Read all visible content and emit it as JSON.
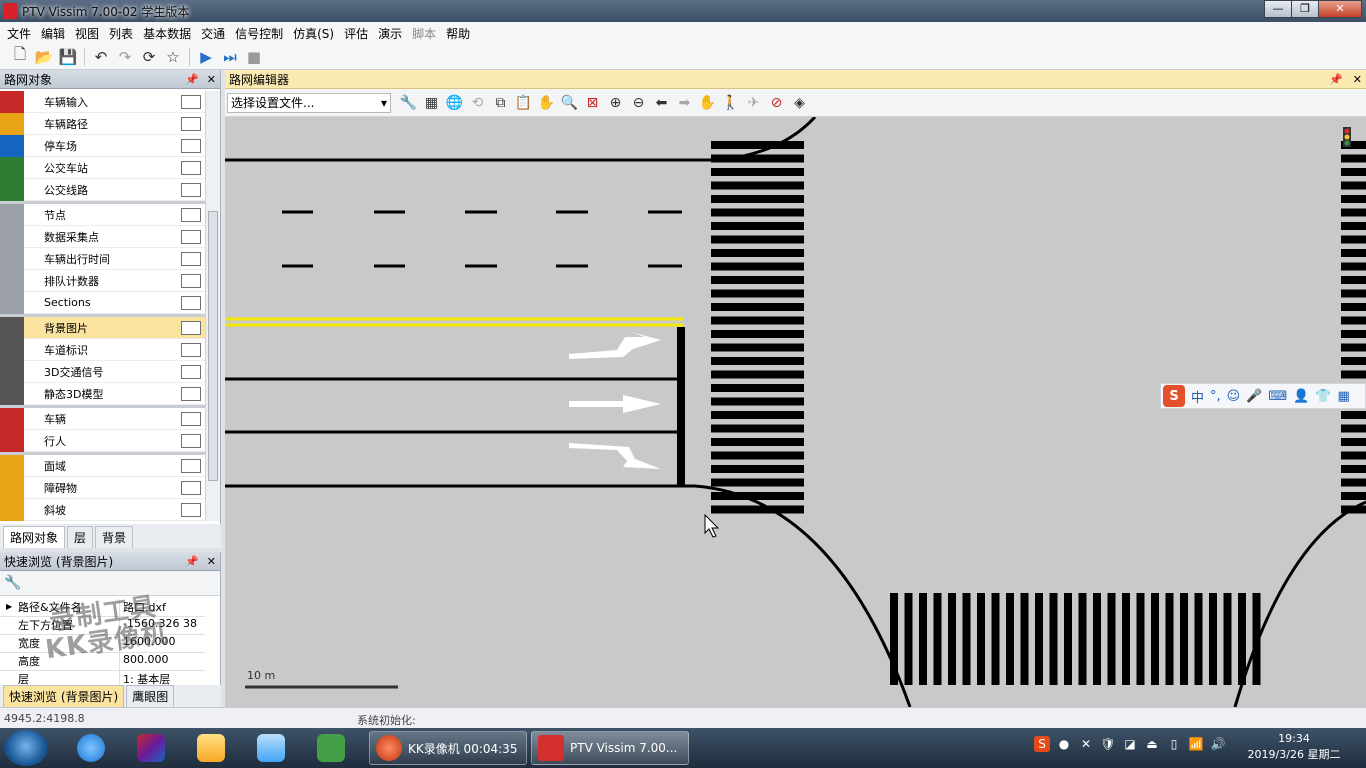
{
  "window": {
    "title": "PTV Vissim 7.00-02 学生版本",
    "minimize": "—",
    "restore": "❐",
    "close": "✕"
  },
  "menu": [
    {
      "label": "文件",
      "enabled": true
    },
    {
      "label": "编辑",
      "enabled": true
    },
    {
      "label": "视图",
      "enabled": true
    },
    {
      "label": "列表",
      "enabled": true
    },
    {
      "label": "基本数据",
      "enabled": true
    },
    {
      "label": "交通",
      "enabled": true
    },
    {
      "label": "信号控制",
      "enabled": true
    },
    {
      "label": "仿真(S)",
      "enabled": true
    },
    {
      "label": "评估",
      "enabled": true
    },
    {
      "label": "演示",
      "enabled": true
    },
    {
      "label": "脚本",
      "enabled": false
    },
    {
      "label": "帮助",
      "enabled": true
    }
  ],
  "network_objects_panel": {
    "title": "路网对象",
    "items": [
      {
        "label": "车辆输入",
        "icon": "car-input-icon",
        "color": "#c62828"
      },
      {
        "label": "车辆路径",
        "icon": "route-icon",
        "color": "#e8a317"
      },
      {
        "label": "停车场",
        "icon": "parking-icon",
        "color": "#1565c0"
      },
      {
        "label": "公交车站",
        "icon": "bus-stop-icon",
        "color": "#2e7d32"
      },
      {
        "label": "公交线路",
        "icon": "bus-line-icon",
        "color": "#2e7d32"
      },
      {
        "label": "节点",
        "icon": "node-icon",
        "color": "#9aa0a6"
      },
      {
        "label": "数据采集点",
        "icon": "data-collection-icon",
        "color": "#9aa0a6"
      },
      {
        "label": "车辆出行时间",
        "icon": "travel-time-icon",
        "color": "#9aa0a6"
      },
      {
        "label": "排队计数器",
        "icon": "queue-counter-icon",
        "color": "#9aa0a6"
      },
      {
        "label": "Sections",
        "icon": "sections-icon",
        "color": "#9aa0a6"
      },
      {
        "label": "背景图片",
        "icon": "background-image-icon",
        "color": "#555555"
      },
      {
        "label": "车道标识",
        "icon": "lane-marking-icon",
        "color": "#555555"
      },
      {
        "label": "3D交通信号",
        "icon": "3d-signal-icon",
        "color": "#555555"
      },
      {
        "label": "静态3D模型",
        "icon": "static-3d-icon",
        "color": "#555555"
      },
      {
        "label": "车辆",
        "icon": "vehicle-icon",
        "color": "#c62828"
      },
      {
        "label": "行人",
        "icon": "pedestrian-icon",
        "color": "#c62828"
      },
      {
        "label": "面域",
        "icon": "area-icon",
        "color": "#e8a317"
      },
      {
        "label": "障碍物",
        "icon": "obstacle-icon",
        "color": "#e8a317"
      },
      {
        "label": "斜坡",
        "icon": "ramp-icon",
        "color": "#e8a317"
      }
    ],
    "selected": "背景图片",
    "tabs": [
      "路网对象",
      "层",
      "背景"
    ]
  },
  "quick_view": {
    "title": "快速浏览 (背景图片)",
    "rows": [
      {
        "key": "路径&文件名",
        "value": "路口.dxf"
      },
      {
        "key": "左下方位置",
        "value": "-1560.326 38"
      },
      {
        "key": "宽度",
        "value": "1600.000"
      },
      {
        "key": "高度",
        "value": "800.000"
      },
      {
        "key": "层",
        "value": "1: 基本层"
      }
    ],
    "tabs": [
      "快速浏览 (背景图片)",
      "鹰眼图"
    ],
    "watermark_top": "录制工具",
    "watermark_bottom": "KK录像机"
  },
  "network_editor": {
    "title": "路网编辑器",
    "select_placeholder": "选择设置文件...",
    "scale_label": "10 m"
  },
  "ime": {
    "logo": "S",
    "mode": "中",
    "punct": "°,"
  },
  "status": {
    "coords": "4945.2:4198.8",
    "message": "系统初始化:"
  },
  "taskbar": {
    "tasks": [
      {
        "label": "KK录像机 00:04:35"
      },
      {
        "label": "PTV Vissim 7.00..."
      }
    ],
    "time": "19:34",
    "date": "2019/3/26 星期二"
  }
}
